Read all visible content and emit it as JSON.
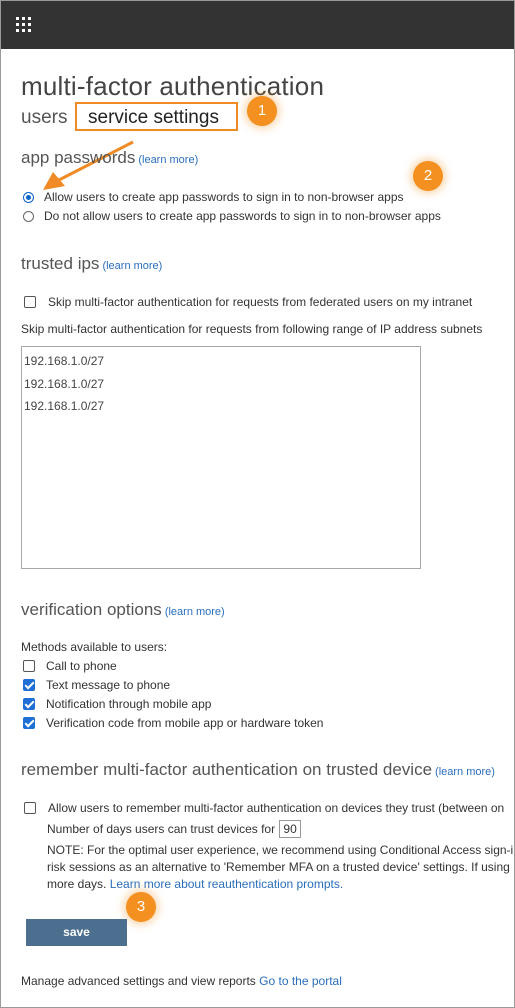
{
  "page_title": "multi-factor authentication",
  "tabs": {
    "users": "users",
    "service_settings": "service settings"
  },
  "badges": [
    "1",
    "2",
    "3"
  ],
  "app_passwords": {
    "heading": "app passwords",
    "learn_more": "(learn more)",
    "option_allow": "Allow users to create app passwords to sign in to non-browser apps",
    "option_deny": "Do not allow users to create app passwords to sign in to non-browser apps",
    "selected": "allow"
  },
  "trusted_ips": {
    "heading": "trusted ips",
    "learn_more": "(learn more)",
    "skip_federated": "Skip multi-factor authentication for requests from federated users on my intranet",
    "skip_range_label": "Skip multi-factor authentication for requests from following range of IP address subnets",
    "subnets": [
      "192.168.1.0/27",
      "192.168.1.0/27",
      "192.168.1.0/27"
    ]
  },
  "verification": {
    "heading": "verification options",
    "learn_more": "(learn more)",
    "methods_label": "Methods available to users:",
    "methods": [
      {
        "label": "Call to phone",
        "checked": false
      },
      {
        "label": "Text message to phone",
        "checked": true
      },
      {
        "label": "Notification through mobile app",
        "checked": true
      },
      {
        "label": "Verification code from mobile app or hardware token",
        "checked": true
      }
    ]
  },
  "remember": {
    "heading": "remember multi-factor authentication on trusted device",
    "learn_more": "(learn more)",
    "allow_label": "Allow users to remember multi-factor authentication on devices they trust (between on",
    "days_label": "Number of days users can trust devices for",
    "days_value": "90",
    "note_line1": "NOTE: For the optimal user experience, we recommend using Conditional Access sign-i",
    "note_line2": "risk sessions as an alternative to 'Remember MFA on a trusted device' settings. If using",
    "note_line3_prefix": "more days. ",
    "note_link": "Learn more about reauthentication prompts."
  },
  "save_label": "save",
  "footer": {
    "text": "Manage advanced settings and view reports ",
    "link": "Go to the portal"
  },
  "colors": {
    "topbar": "#333333",
    "accent": "#f39020",
    "link": "#2a6ebb",
    "save": "#4d6f8f"
  }
}
